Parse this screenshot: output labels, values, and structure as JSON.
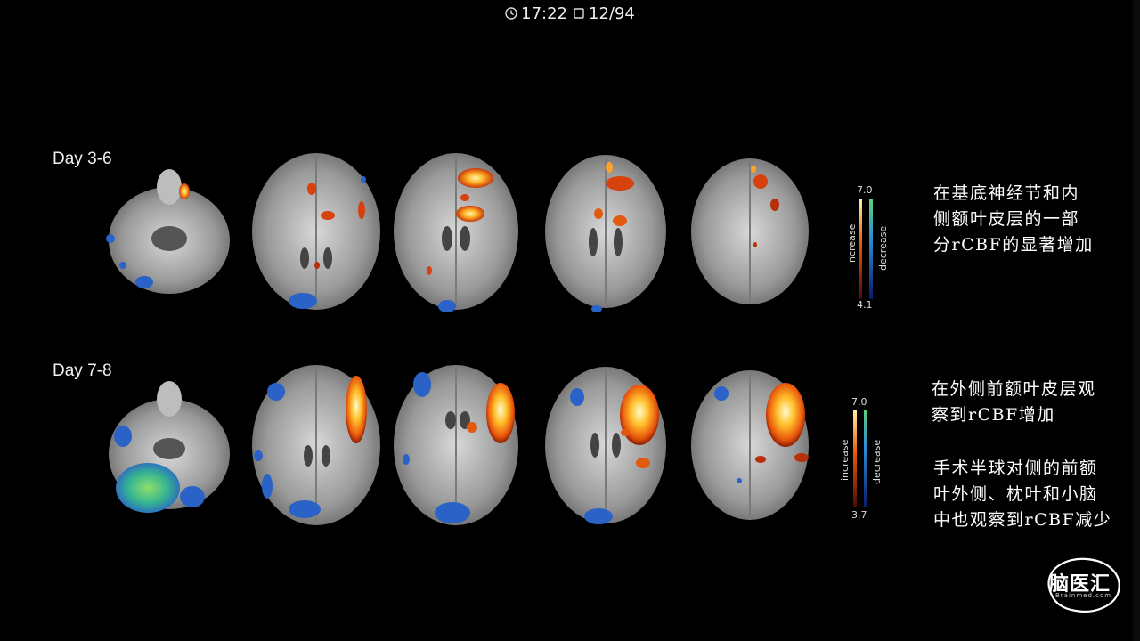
{
  "status_bar": {
    "time": "17:22",
    "page": "12/94",
    "clock_icon": "clock-icon",
    "page_icon": "page-icon"
  },
  "figure": {
    "rows": [
      {
        "label": "Day 3-6",
        "colorbar": {
          "max": "7.0",
          "min": "4.1",
          "increase_label": "increase",
          "decrease_label": "decrease"
        }
      },
      {
        "label": "Day 7-8",
        "colorbar": {
          "max": "7.0",
          "min": "3.7",
          "increase_label": "increase",
          "decrease_label": "decrease"
        }
      }
    ]
  },
  "notes": {
    "row1": [
      "在基底神经节和内",
      "侧额叶皮层的一部",
      "分rCBF的显著增加"
    ],
    "row2a": [
      "在外侧前额叶皮层观",
      "察到rCBF增加"
    ],
    "row2b": [
      "手术半球对侧的前额",
      "叶外侧、枕叶和小脑",
      "中也观察到rCBF减少"
    ]
  },
  "logo": {
    "text": "脑医汇",
    "sub": "Brainmed.com"
  },
  "colors": {
    "increase_hot": "#ffd24a",
    "increase_mid": "#e25a10",
    "decrease": "#2a6fd6",
    "decrease_light": "#43c07a"
  }
}
